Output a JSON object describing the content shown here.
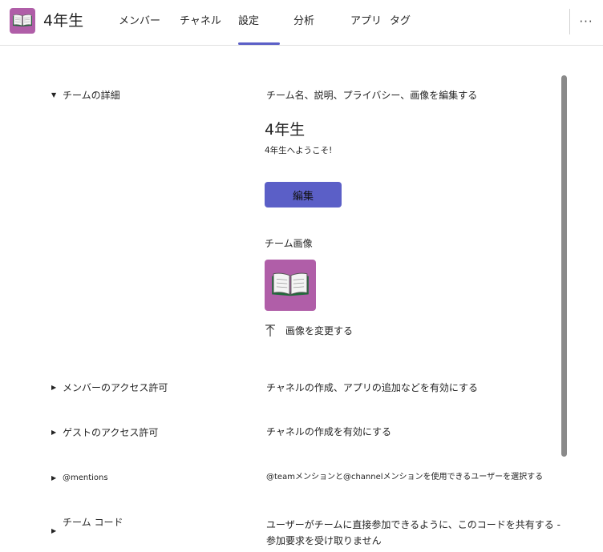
{
  "header": {
    "team_name": "4年生",
    "tabs": [
      {
        "label": "メンバー"
      },
      {
        "label": "チャネル"
      },
      {
        "label": "設定"
      },
      {
        "label": "分析"
      },
      {
        "label": "アプリ"
      },
      {
        "label": "タグ"
      }
    ],
    "active_tab": "設定",
    "accent_color": "#5b5fc7",
    "avatar_color": "#b05ea8",
    "avatar_icon": "book-icon",
    "more_icon": "more-options-icon"
  },
  "sections": {
    "team_details": {
      "label": "チームの詳細",
      "description": "チーム名、説明、プライバシー、画像を編集する",
      "expanded": true,
      "team_title": "4年生",
      "team_description": "4年生へようこそ!",
      "edit_button": "編集",
      "team_image_label": "チーム画像",
      "change_image_label": "画像を変更する"
    },
    "member_permissions": {
      "label": "メンバーのアクセス許可",
      "description": "チャネルの作成、アプリの追加などを有効にする"
    },
    "guest_permissions": {
      "label": "ゲストのアクセス許可",
      "description": "チャネルの作成を有効にする"
    },
    "mentions": {
      "label": "@mentions",
      "description": "@teamメンションと@channelメンションを使用できるユーザーを選択する"
    },
    "team_code": {
      "label": "チーム コード",
      "description_line1": "ユーザーがチームに直接参加できるように、このコードを共有する -",
      "description_line2": "参加要求を受け取りません"
    }
  }
}
